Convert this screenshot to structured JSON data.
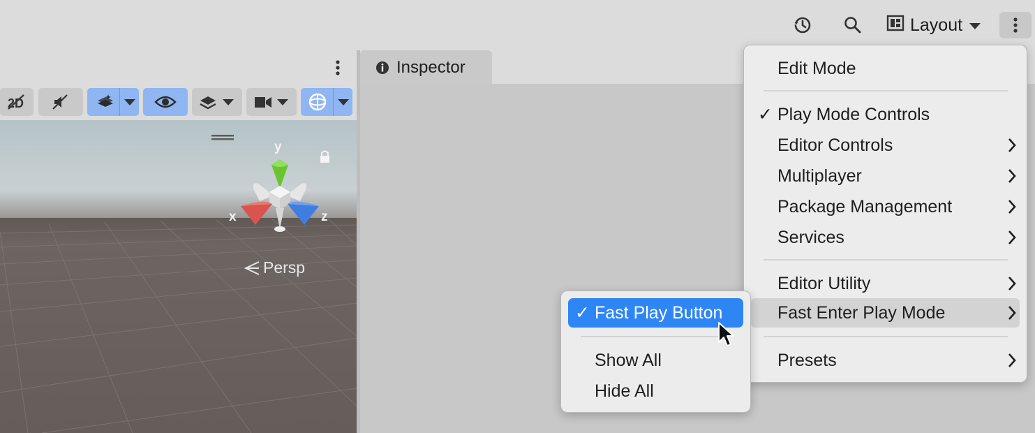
{
  "toolbar": {
    "layout_label": "Layout",
    "icons": [
      "history-icon",
      "search-icon",
      "layout-icon",
      "chevron-down-icon",
      "more-vertical-icon"
    ]
  },
  "inspector": {
    "tab_label": "Inspector"
  },
  "scene": {
    "axis_y": "y",
    "axis_x": "x",
    "axis_z": "z",
    "projection_label": "Persp",
    "colors": {
      "sky": "#c3ced2",
      "ground": "#6b6460",
      "highlight_blue": "#8fb6f2"
    }
  },
  "main_menu": {
    "edit_mode": "Edit Mode",
    "play_mode_controls": "Play Mode Controls",
    "editor_controls": "Editor Controls",
    "multiplayer": "Multiplayer",
    "package_management": "Package Management",
    "services": "Services",
    "editor_utility": "Editor Utility",
    "fast_enter_play_mode": "Fast Enter Play Mode",
    "presets": "Presets",
    "checkmark": "✓"
  },
  "sub_menu": {
    "fast_play_button": "Fast Play Button",
    "show_all": "Show All",
    "hide_all": "Hide All",
    "checkmark": "✓"
  },
  "colors": {
    "selection": "#2e86f5",
    "menu_bg": "#ececec",
    "hover_bg": "#d3d3d3"
  }
}
